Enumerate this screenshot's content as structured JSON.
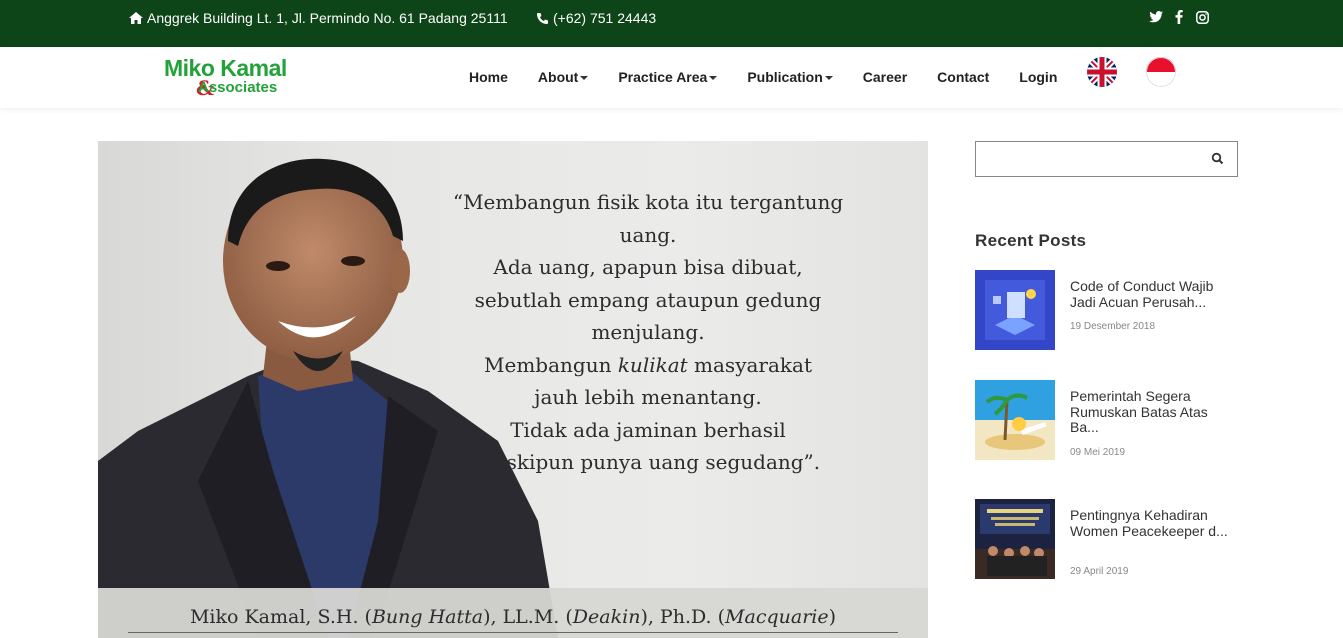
{
  "topbar": {
    "address": "Anggrek Building Lt. 1, Jl. Permindo No. 61 Padang 25111",
    "phone": "(+62) 751 24443",
    "social": [
      "twitter-icon",
      "facebook-icon",
      "instagram-icon"
    ]
  },
  "logo": {
    "line1": "Miko Kamal",
    "line2": "Associates",
    "ampersand": "&"
  },
  "nav": {
    "items": [
      {
        "label": "Home",
        "dropdown": false
      },
      {
        "label": "About",
        "dropdown": true
      },
      {
        "label": "Practice Area",
        "dropdown": true
      },
      {
        "label": "Publication",
        "dropdown": true
      },
      {
        "label": "Career",
        "dropdown": false
      },
      {
        "label": "Contact",
        "dropdown": false
      },
      {
        "label": "Login",
        "dropdown": false
      }
    ],
    "languages": [
      "English",
      "Indonesia"
    ]
  },
  "hero": {
    "quote_lines": [
      "“Membangun fisik kota itu tergantung uang.",
      "Ada uang, apapun bisa dibuat,",
      "sebutlah empang ataupun gedung menjulang.",
      "Membangun kulikat masyarakat",
      "jauh lebih menantang.",
      "Tidak ada jaminan berhasil",
      "meskipun punya uang segudang”."
    ],
    "caption": "Miko Kamal, S.H. (Bung Hatta), LL.M. (Deakin), Ph.D. (Macquarie)"
  },
  "sidebar": {
    "search_placeholder": "",
    "recent_title": "Recent Posts",
    "posts": [
      {
        "title": "Code of Conduct Wajib Jadi Acuan Perusah...",
        "date": "19 Desember 2018"
      },
      {
        "title": "Pemerintah Segera Rumuskan Batas Atas Ba...",
        "date": "09 Mei 2019"
      },
      {
        "title": "Pentingnya Kehadiran Women Peacekeeper d...",
        "date": "29 April 2019"
      }
    ]
  },
  "colors": {
    "topbar": "#0d4418",
    "brand_green": "#23a13a",
    "brand_red": "#d0202c"
  }
}
